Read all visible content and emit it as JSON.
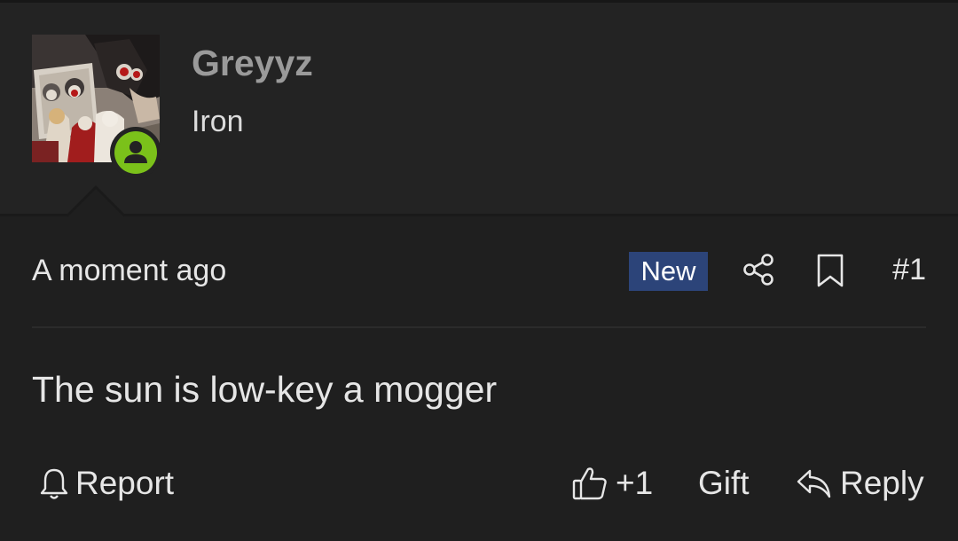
{
  "user": {
    "name": "Greyyz",
    "title": "Iron",
    "avatar_icon": "manga-avatar-image",
    "status_icon": "online-user-icon",
    "status_color": "#7bc11a"
  },
  "post": {
    "time": "A moment ago",
    "badge": "New",
    "badge_color": "#2c4479",
    "number": "#1",
    "message": "The sun is low-key a mogger"
  },
  "actions": {
    "report": "Report",
    "like_count": "+1",
    "gift": "Gift",
    "reply": "Reply"
  },
  "icons": [
    "share-icon",
    "bookmark-icon",
    "bell-icon",
    "thumbs-up-icon",
    "reply-icon"
  ],
  "colors": {
    "background": "#1f1f1f",
    "header_background": "#232323",
    "username": "#9a9a9a",
    "text": "#e6e6e6"
  }
}
